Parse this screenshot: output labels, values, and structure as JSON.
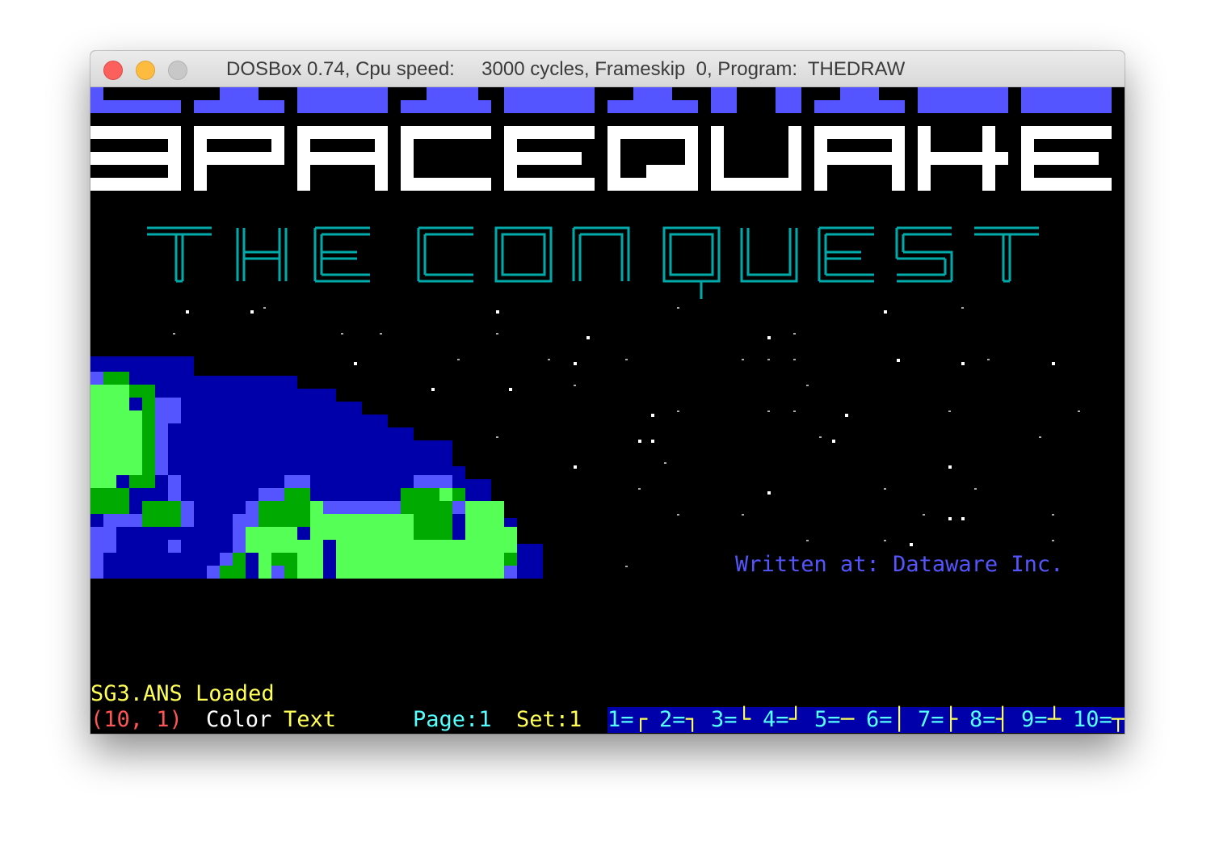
{
  "window": {
    "title": "DOSBox 0.74, Cpu speed:     3000 cycles, Frameskip  0, Program:  THEDRAW"
  },
  "artwork": {
    "credit": "Written at: Dataware Inc."
  },
  "status": {
    "message": "SG3.ANS Loaded",
    "cursor": "(10, 1)",
    "color_label": "Color",
    "text_sample": "Text",
    "page": "Page:1",
    "set": "Set:1"
  },
  "charset_keys": [
    {
      "key": "1=",
      "glyph": "┌"
    },
    {
      "key": "2=",
      "glyph": "┐"
    },
    {
      "key": "3=",
      "glyph": "└"
    },
    {
      "key": "4=",
      "glyph": "┘"
    },
    {
      "key": "5=",
      "glyph": "─"
    },
    {
      "key": "6=",
      "glyph": "│"
    },
    {
      "key": "7=",
      "glyph": "├"
    },
    {
      "key": "8=",
      "glyph": "┤"
    },
    {
      "key": "9=",
      "glyph": "┴"
    },
    {
      "key": "10=",
      "glyph": "┬"
    }
  ],
  "colors": {
    "black": "#000000",
    "blue": "#0000aa",
    "light_blue": "#5555ff",
    "green": "#00aa00",
    "light_green": "#55ff55",
    "cyan": "#00aaaa",
    "light_cyan": "#55ffff",
    "light_red": "#ff5555",
    "yellow": "#ffff55",
    "white": "#ffffff",
    "light_gray": "#aaaaaa"
  }
}
